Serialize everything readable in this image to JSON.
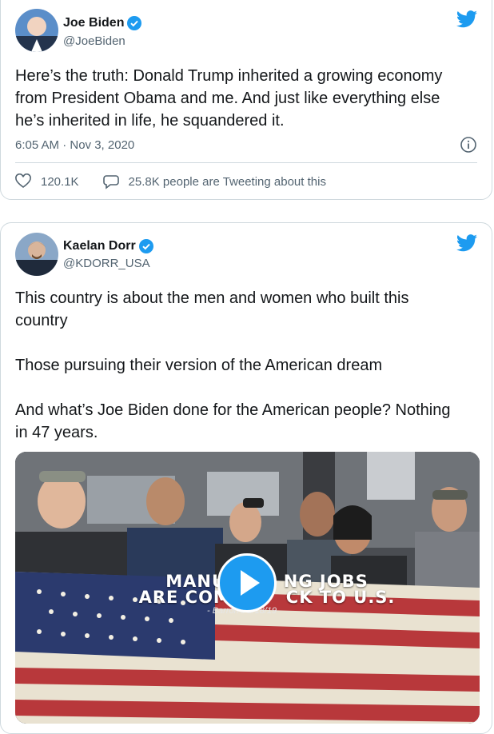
{
  "tweets": [
    {
      "name": "Joe Biden",
      "handle": "@JoeBiden",
      "text": "Here’s the truth: Donald Trump inherited a growing economy\nfrom President Obama and me. And just like everything else\nhe’s inherited in life, he squandered it.",
      "timestamp": "6:05 AM · Nov 3, 2020",
      "likes": "120.1K",
      "replies_text": "25.8K people are Tweeting about this"
    },
    {
      "name": "Kaelan Dorr",
      "handle": "@KDORR_USA",
      "text": "This country is about the men and women who built this\ncountry\n\nThose pursuing their version of the American dream\n\nAnd what’s Joe Biden done for the American people? Nothing\nin 47 years.",
      "media_overlay": "MANUFA     NG JOBS\nARE COMIN     CK TO U.S.",
      "media_source": "- Barron's  2/18/19"
    }
  ],
  "icons": [
    "verified-badge-icon",
    "twitter-bird-icon",
    "info-icon",
    "heart-icon",
    "reply-icon",
    "play-icon"
  ],
  "colors": {
    "twitter_blue": "#1d9bf0",
    "secondary_text": "#536471",
    "border": "#cfd9de"
  }
}
